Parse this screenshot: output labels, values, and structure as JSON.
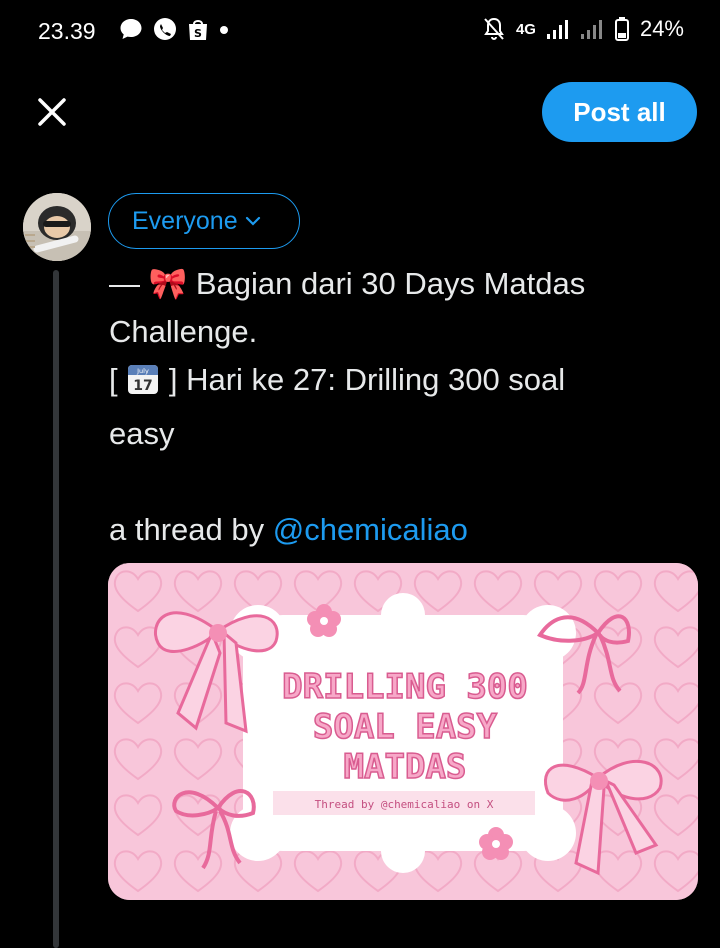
{
  "status_bar": {
    "time": "23.39",
    "network": "4G",
    "battery": "24%"
  },
  "header": {
    "post_all_label": "Post all"
  },
  "composer": {
    "audience_label": "Everyone",
    "lines": [
      "— 🎀 Bagian dari 30 Days Matdas",
      "Challenge.",
      "[",
      "] Hari ke 27: Drilling 300 soal",
      "easy",
      "a thread by",
      "@chemicaliao"
    ],
    "calendar_month": "July",
    "calendar_day": "17"
  },
  "media": {
    "title_line1": "DRILLING 300",
    "title_line2": "SOAL EASY",
    "title_line3": "MATDAS",
    "caption": "Thread by @chemicaliao on X"
  },
  "colors": {
    "accent": "#1d9bf0",
    "background": "#000000",
    "text": "#e7e9ea"
  }
}
